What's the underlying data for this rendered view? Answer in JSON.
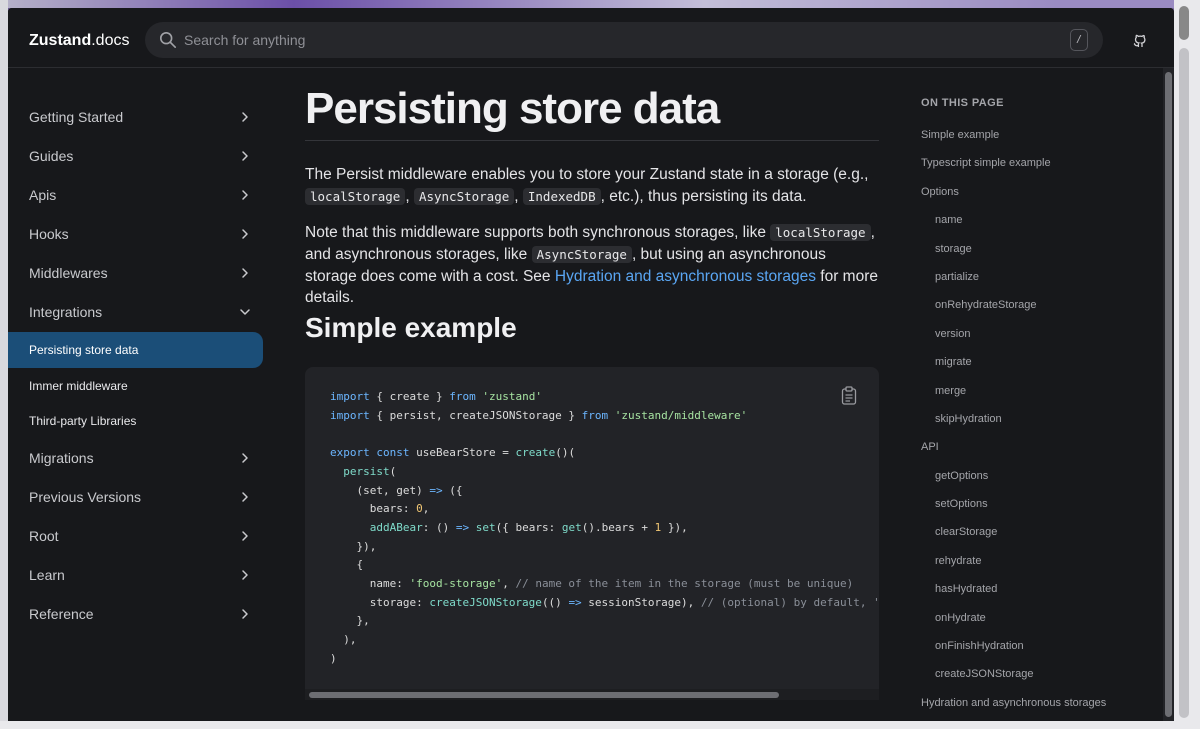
{
  "header": {
    "logo_bold": "Zustand",
    "logo_rest": ".docs",
    "search_placeholder": "Search for anything",
    "search_shortcut": "/"
  },
  "sidebar": {
    "items": [
      {
        "label": "Getting Started"
      },
      {
        "label": "Guides"
      },
      {
        "label": "Apis"
      },
      {
        "label": "Hooks"
      },
      {
        "label": "Middlewares"
      },
      {
        "label": "Integrations"
      }
    ],
    "sub_items": [
      {
        "label": "Persisting store data",
        "active": true
      },
      {
        "label": "Immer middleware"
      },
      {
        "label": "Third-party Libraries"
      }
    ],
    "items_after": [
      {
        "label": "Migrations"
      },
      {
        "label": "Previous Versions"
      },
      {
        "label": "Root"
      },
      {
        "label": "Learn"
      },
      {
        "label": "Reference"
      }
    ]
  },
  "main": {
    "title": "Persisting store data",
    "p1_text_a": "The Persist middleware enables you to store your Zustand state in a storage (e.g.,",
    "p1_code_1": "localStorage",
    "p1_sep_1": ",",
    "p1_code_2": "AsyncStorage",
    "p1_sep_2": ",",
    "p1_code_3": "IndexedDB",
    "p1_text_b": ", etc.), thus persisting its data.",
    "p2_text_a": "Note that this middleware supports both synchronous storages, like",
    "p2_code_1": "localStorage",
    "p2_text_b": ", and asynchronous storages, like",
    "p2_code_2": "AsyncStorage",
    "p2_text_c": ", but using an asynchronous storage does come with a cost. See",
    "p2_link": "Hydration and asynchronous storages",
    "p2_text_d": "for more details.",
    "h2": "Simple example"
  },
  "toc": {
    "title": "ON THIS PAGE",
    "items": [
      {
        "label": "Simple example",
        "indent": false
      },
      {
        "label": "Typescript simple example",
        "indent": false
      },
      {
        "label": "Options",
        "indent": false
      },
      {
        "label": "name",
        "indent": true
      },
      {
        "label": "storage",
        "indent": true
      },
      {
        "label": "partialize",
        "indent": true
      },
      {
        "label": "onRehydrateStorage",
        "indent": true
      },
      {
        "label": "version",
        "indent": true
      },
      {
        "label": "migrate",
        "indent": true
      },
      {
        "label": "merge",
        "indent": true
      },
      {
        "label": "skipHydration",
        "indent": true
      },
      {
        "label": "API",
        "indent": false
      },
      {
        "label": "getOptions",
        "indent": true
      },
      {
        "label": "setOptions",
        "indent": true
      },
      {
        "label": "clearStorage",
        "indent": true
      },
      {
        "label": "rehydrate",
        "indent": true
      },
      {
        "label": "hasHydrated",
        "indent": true
      },
      {
        "label": "onHydrate",
        "indent": true
      },
      {
        "label": "onFinishHydration",
        "indent": true
      },
      {
        "label": "createJSONStorage",
        "indent": true
      },
      {
        "label": "Hydration and asynchronous storages",
        "indent": false
      }
    ]
  },
  "code": {
    "lines": [
      [
        [
          "kw",
          "import"
        ],
        [
          "t",
          " { create } "
        ],
        [
          "kw",
          "from"
        ],
        [
          "t",
          " "
        ],
        [
          "str",
          "'zustand'"
        ]
      ],
      [
        [
          "kw",
          "import"
        ],
        [
          "t",
          " { persist, createJSONStorage } "
        ],
        [
          "kw",
          "from"
        ],
        [
          "t",
          " "
        ],
        [
          "str",
          "'zustand/middleware'"
        ]
      ],
      [],
      [
        [
          "kw",
          "export"
        ],
        [
          "t",
          " "
        ],
        [
          "kw",
          "const"
        ],
        [
          "t",
          " useBearStore = "
        ],
        [
          "fn",
          "create"
        ],
        [
          "t",
          "()("
        ]
      ],
      [
        [
          "t",
          "  "
        ],
        [
          "fn",
          "persist"
        ],
        [
          "t",
          "("
        ]
      ],
      [
        [
          "t",
          "    (set, get) "
        ],
        [
          "kw",
          "=>"
        ],
        [
          "t",
          " ({"
        ]
      ],
      [
        [
          "t",
          "      bears: "
        ],
        [
          "num",
          "0"
        ],
        [
          "t",
          ","
        ]
      ],
      [
        [
          "t",
          "      "
        ],
        [
          "fn",
          "addABear"
        ],
        [
          "t",
          ": () "
        ],
        [
          "kw",
          "=>"
        ],
        [
          "t",
          " "
        ],
        [
          "fn",
          "set"
        ],
        [
          "t",
          "({ bears: "
        ],
        [
          "fn",
          "get"
        ],
        [
          "t",
          "().bears + "
        ],
        [
          "num",
          "1"
        ],
        [
          "t",
          " }),"
        ]
      ],
      [
        [
          "t",
          "    }),"
        ]
      ],
      [
        [
          "t",
          "    {"
        ]
      ],
      [
        [
          "t",
          "      name: "
        ],
        [
          "str",
          "'food-storage'"
        ],
        [
          "t",
          ", "
        ],
        [
          "cmt",
          "// name of the item in the storage (must be unique)"
        ]
      ],
      [
        [
          "t",
          "      storage: "
        ],
        [
          "fn",
          "createJSONStorage"
        ],
        [
          "t",
          "(() "
        ],
        [
          "kw",
          "=>"
        ],
        [
          "t",
          " sessionStorage), "
        ],
        [
          "cmt",
          "// (optional) by default, 'localStorage' is used"
        ]
      ],
      [
        [
          "t",
          "    },"
        ]
      ],
      [
        [
          "t",
          "  ),"
        ]
      ],
      [
        [
          "t",
          ")"
        ]
      ]
    ]
  }
}
